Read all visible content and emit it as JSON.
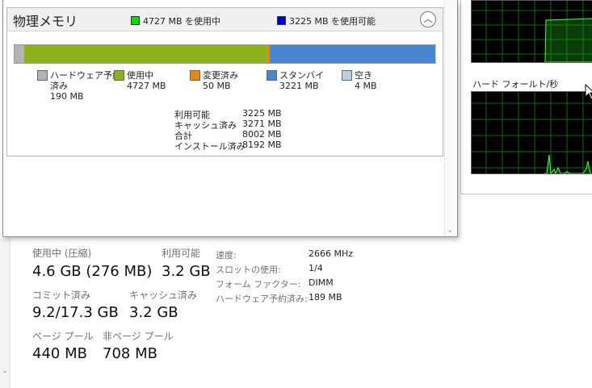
{
  "background": {
    "stats": {
      "in_use_label": "使用中 (圧縮)",
      "in_use_value": "4.6 GB (276 MB)",
      "available_label": "利用可能",
      "available_value": "3.2 GB",
      "committed_label": "コミット済み",
      "committed_value": "9.2/17.3 GB",
      "cached_label": "キャッシュ済み",
      "cached_value": "3.2 GB",
      "paged_pool_label": "ページ プール",
      "paged_pool_value": "440 MB",
      "nonpaged_pool_label": "非ページ プール",
      "nonpaged_pool_value": "708 MB"
    },
    "specs": {
      "speed_label": "速度:",
      "speed_value": "2666 MHz",
      "slots_label": "スロットの使用:",
      "slots_value": "1/4",
      "form_factor_label": "フォーム ファクター:",
      "form_factor_value": "DIMM",
      "hw_reserved_label": "ハードウェア予約済み:",
      "hw_reserved_value": "189 MB"
    },
    "graph_panel": {
      "hard_faults_title": "ハード フォールト/秒"
    }
  },
  "popup": {
    "title": "物理メモリ",
    "header_legend": [
      {
        "text": "4727 MB を使用中",
        "color": "#00e000"
      },
      {
        "text": "3225 MB を使用可能",
        "color": "#0000d0"
      }
    ],
    "bar": [
      {
        "name": "hardware-reserved",
        "value_mb": 190,
        "color": "#b4b4b4"
      },
      {
        "name": "in-use",
        "value_mb": 4727,
        "color": "#8db21c"
      },
      {
        "name": "modified",
        "value_mb": 50,
        "color": "#e8860e"
      },
      {
        "name": "standby",
        "value_mb": 3221,
        "color": "#4a86d0"
      },
      {
        "name": "free",
        "value_mb": 4,
        "color": "#b8cfea"
      }
    ],
    "legend": [
      {
        "line1": "ハードウェア予約",
        "line2": "済み",
        "line3": "190 MB",
        "color": "#b4b4b4"
      },
      {
        "line1": "使用中",
        "line2": "4727 MB",
        "line3": "",
        "color": "#8db21c"
      },
      {
        "line1": "変更済み",
        "line2": "50 MB",
        "line3": "",
        "color": "#e8860e"
      },
      {
        "line1": "スタンバイ",
        "line2": "3221 MB",
        "line3": "",
        "color": "#4a86d0"
      },
      {
        "line1": "空き",
        "line2": "4 MB",
        "line3": "",
        "color": "#b8cfea"
      }
    ],
    "totals": [
      {
        "label": "利用可能",
        "value": "3225 MB"
      },
      {
        "label": "キャッシュ済み",
        "value": "3271 MB"
      },
      {
        "label": "合計",
        "value": "8002 MB"
      },
      {
        "label": "インストール済み",
        "value": "8192 MB"
      }
    ]
  },
  "icons": {
    "collapse": "chevron-up-icon",
    "scroll_down": "chevron-down-icon",
    "cursor": "mouse-pointer-icon"
  }
}
